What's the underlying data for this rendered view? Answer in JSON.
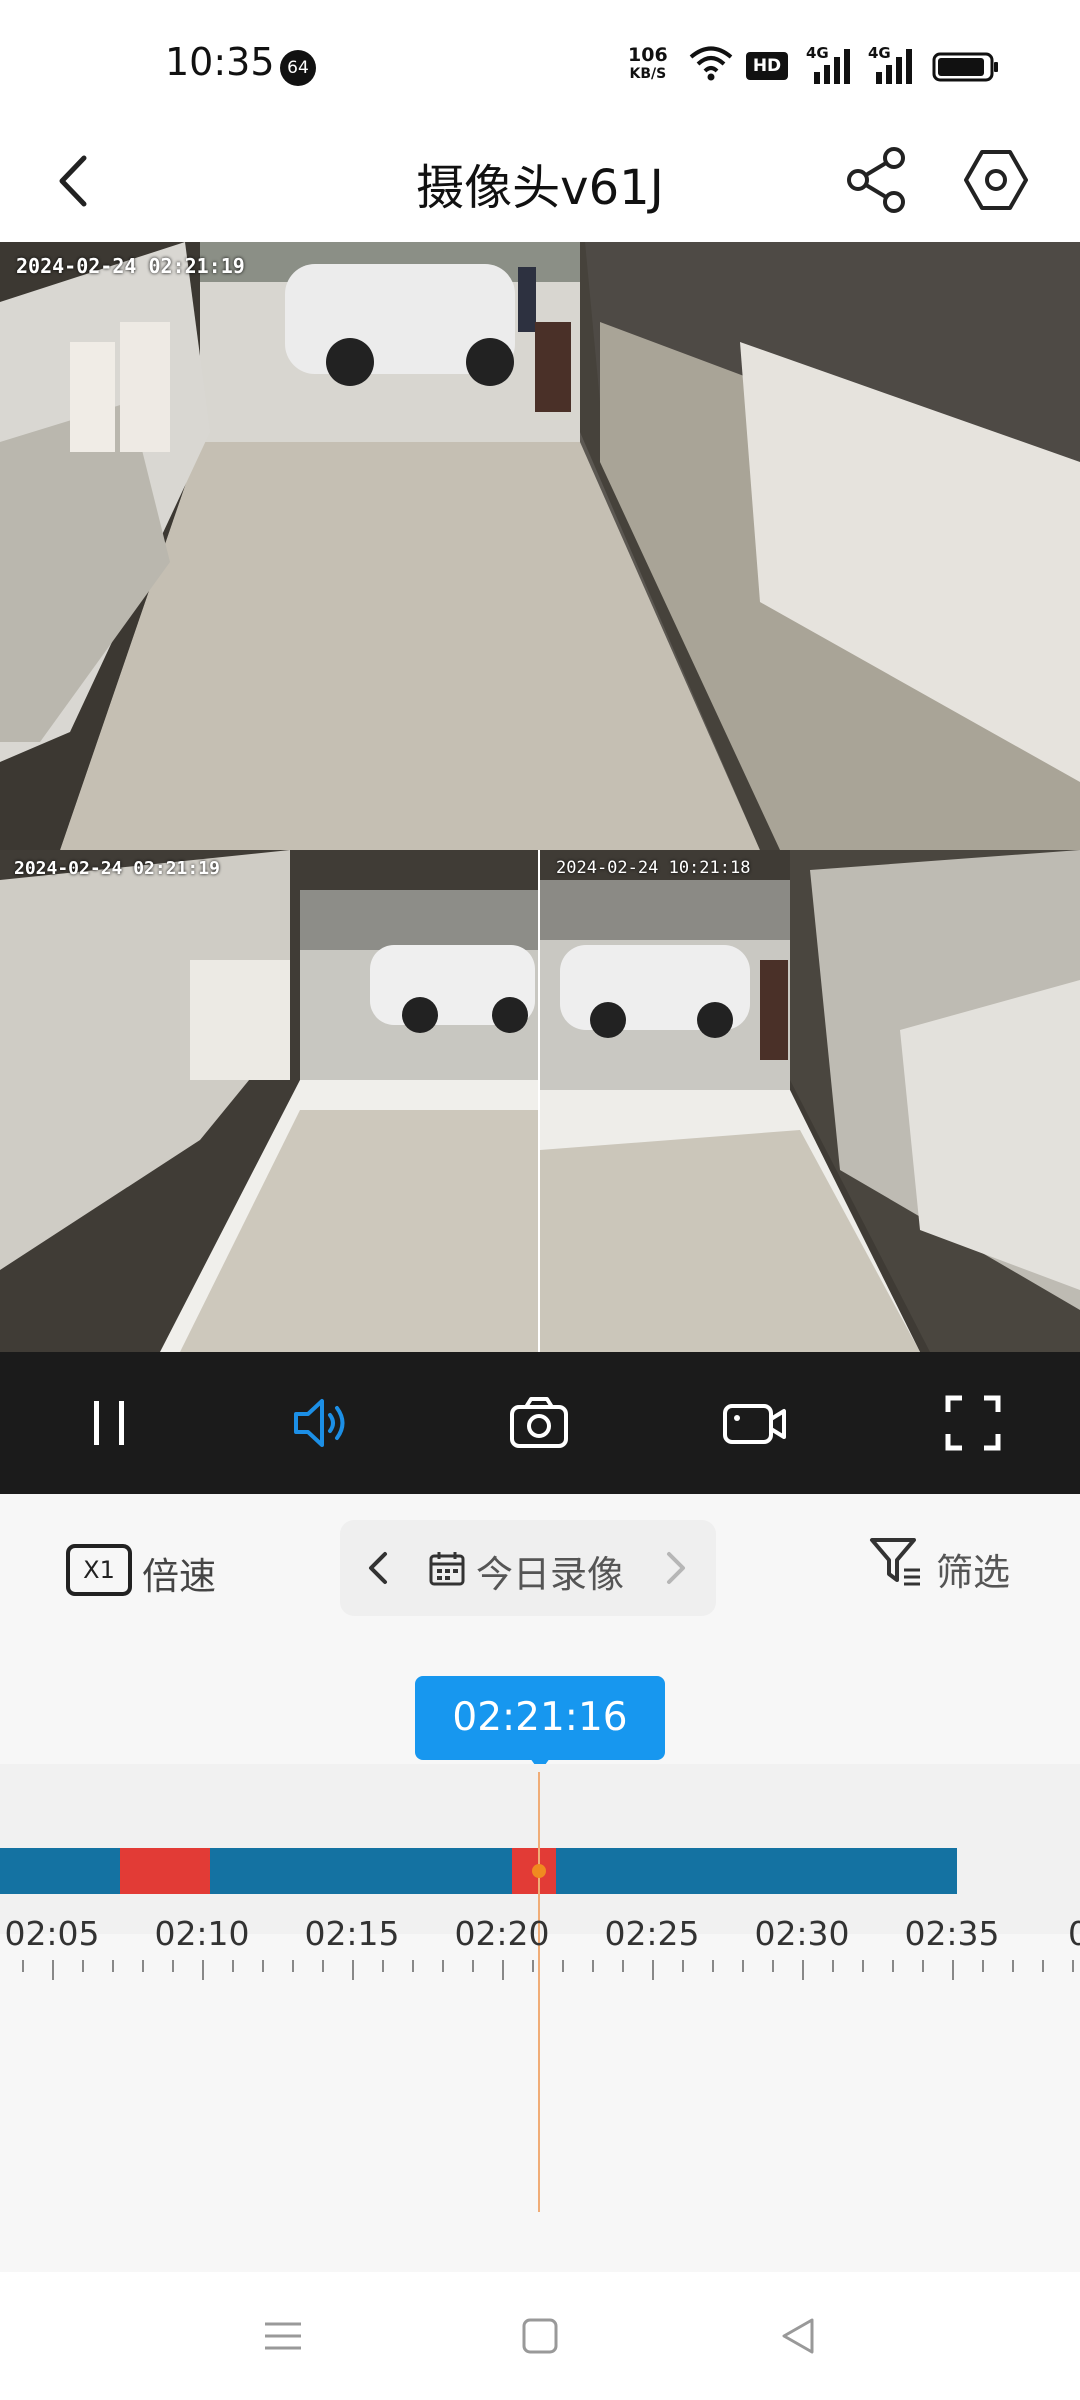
{
  "status_bar": {
    "time": "10:35",
    "notification_count": "64",
    "net_speed_value": "106",
    "net_speed_unit": "KB/S",
    "hd_label": "HD",
    "signal1": "4G",
    "signal2": "4G",
    "icons": [
      "wifi-icon",
      "hd-icon",
      "signal-icon",
      "signal-icon",
      "battery-icon"
    ]
  },
  "header": {
    "title": "摄像头v61J",
    "icons": [
      "back-icon",
      "share-icon",
      "settings-icon"
    ]
  },
  "video": {
    "cam1_timestamp": "2024-02-24 02:21:19",
    "cam2_timestamp": "2024-02-24 02:21:19",
    "cam3_timestamp": "2024-02-24 10:21:18"
  },
  "controls": {
    "icons": [
      "pause-icon",
      "speaker-icon",
      "screenshot-icon",
      "record-icon",
      "fullscreen-icon"
    ],
    "active_color": "#1c8fe6"
  },
  "options": {
    "speed_badge": "X1",
    "speed_label": "倍速",
    "date_label": "今日录像",
    "filter_label": "筛选"
  },
  "timeline": {
    "current_time": "02:21:16",
    "tick_labels": [
      "02:05",
      "02:10",
      "02:15",
      "02:20",
      "02:25",
      "02:30",
      "02:35",
      "0"
    ],
    "recording_color": "#1472a2",
    "alarm_color": "#e23b36"
  }
}
